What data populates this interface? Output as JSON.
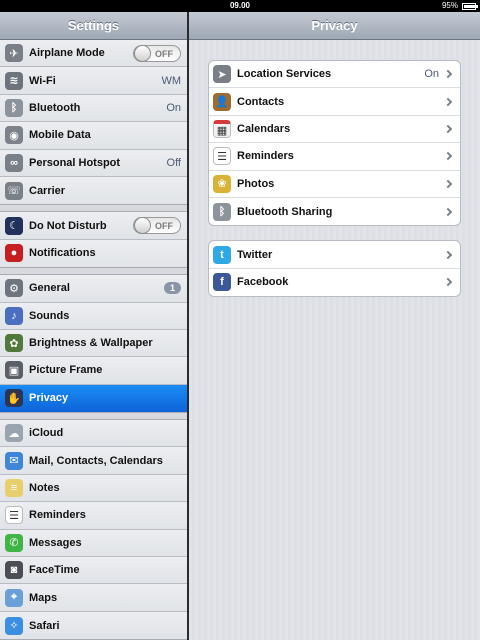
{
  "status": {
    "time": "09.00",
    "battery": "95%",
    "battery_level": 0.95
  },
  "left_panel": {
    "title": "Settings",
    "groups": [
      [
        {
          "label": "Airplane Mode",
          "icon": "airplane-icon",
          "toggle": "OFF"
        },
        {
          "label": "Wi-Fi",
          "icon": "wifi-icon",
          "value": "WM"
        },
        {
          "label": "Bluetooth",
          "icon": "bluetooth-icon",
          "value": "On"
        },
        {
          "label": "Mobile Data",
          "icon": "mobile-data-icon"
        },
        {
          "label": "Personal Hotspot",
          "icon": "hotspot-icon",
          "value": "Off"
        },
        {
          "label": "Carrier",
          "icon": "phone-icon"
        }
      ],
      [
        {
          "label": "Do Not Disturb",
          "icon": "moon-icon",
          "toggle": "OFF"
        },
        {
          "label": "Notifications",
          "icon": "notifications-icon"
        }
      ],
      [
        {
          "label": "General",
          "icon": "gear-icon",
          "badge": "1"
        },
        {
          "label": "Sounds",
          "icon": "speaker-icon"
        },
        {
          "label": "Brightness & Wallpaper",
          "icon": "flower-icon"
        },
        {
          "label": "Picture Frame",
          "icon": "picture-frame-icon"
        },
        {
          "label": "Privacy",
          "icon": "hand-icon",
          "selected": true
        }
      ],
      [
        {
          "label": "iCloud",
          "icon": "cloud-icon"
        },
        {
          "label": "Mail, Contacts, Calendars",
          "icon": "mail-icon"
        },
        {
          "label": "Notes",
          "icon": "notes-icon"
        },
        {
          "label": "Reminders",
          "icon": "reminders-icon"
        },
        {
          "label": "Messages",
          "icon": "messages-icon"
        },
        {
          "label": "FaceTime",
          "icon": "facetime-icon"
        },
        {
          "label": "Maps",
          "icon": "maps-icon"
        },
        {
          "label": "Safari",
          "icon": "compass-icon"
        }
      ]
    ]
  },
  "right_panel": {
    "title": "Privacy",
    "groups": [
      [
        {
          "label": "Location Services",
          "icon": "location-arrow-icon",
          "value": "On"
        },
        {
          "label": "Contacts",
          "icon": "contacts-book-icon"
        },
        {
          "label": "Calendars",
          "icon": "calendar-icon"
        },
        {
          "label": "Reminders",
          "icon": "reminders-icon"
        },
        {
          "label": "Photos",
          "icon": "sunflower-icon"
        },
        {
          "label": "Bluetooth Sharing",
          "icon": "bluetooth-icon"
        }
      ],
      [
        {
          "label": "Twitter",
          "icon": "twitter-bird-icon"
        },
        {
          "label": "Facebook",
          "icon": "facebook-icon"
        }
      ]
    ]
  },
  "colors": {
    "selected": "#1279e8",
    "accent_value": "#4c5a75"
  }
}
